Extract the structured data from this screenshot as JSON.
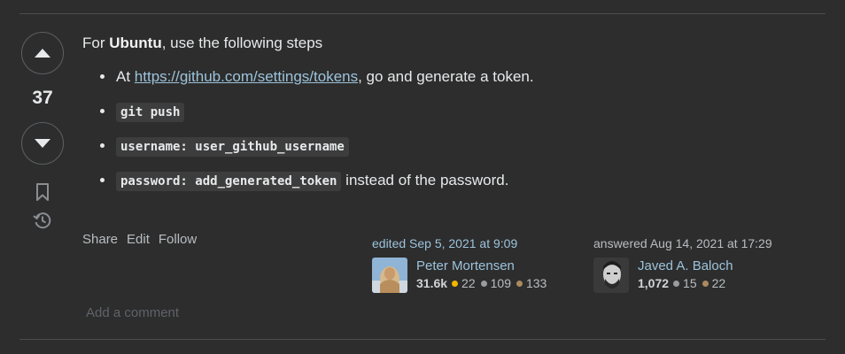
{
  "vote": {
    "score": "37",
    "upvote_icon": "triangle-up-icon",
    "downvote_icon": "triangle-down-icon",
    "bookmark_icon": "bookmark-icon",
    "history_icon": "history-icon"
  },
  "post": {
    "intro_prefix": "For ",
    "intro_bold": "Ubuntu",
    "intro_suffix": ", use the following steps",
    "steps": {
      "step1_prefix": "At ",
      "step1_link": "https://github.com/settings/tokens",
      "step1_suffix": ", go and generate a token.",
      "step2_code": "git push",
      "step3_code": "username: user_github_username",
      "step4_code": "password: add_generated_token",
      "step4_suffix": " instead of the password."
    }
  },
  "menu": {
    "share": "Share",
    "edit": "Edit",
    "follow": "Follow"
  },
  "editor": {
    "action": "edited Sep 5, 2021 at 9:09",
    "name": "Peter Mortensen",
    "reputation": "31.6k",
    "gold": "22",
    "silver": "109",
    "bronze": "133"
  },
  "author": {
    "action": "answered Aug 14, 2021 at 17:29",
    "name": "Javed A. Baloch",
    "reputation": "1,072",
    "silver": "15",
    "bronze": "22"
  },
  "comment": {
    "add_label": "Add a comment"
  },
  "colors": {
    "background": "#2d2d2d",
    "link": "#9cc3db",
    "gold": "#f1b600",
    "silver": "#9a9c9f",
    "bronze": "#ab8a5f"
  }
}
